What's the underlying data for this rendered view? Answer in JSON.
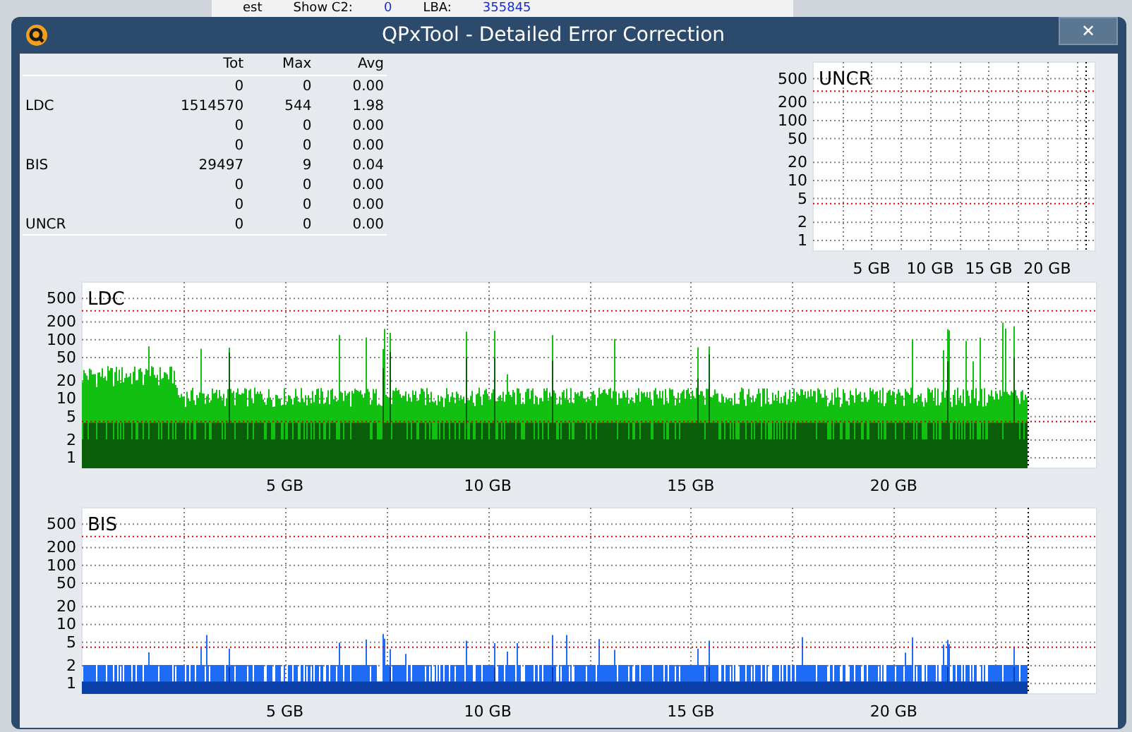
{
  "background_window": {
    "texts": [
      "est",
      "Show C2:",
      "0",
      "LBA:",
      "355845"
    ]
  },
  "window": {
    "title": "QPxTool - Detailed Error Correction",
    "close": "✕"
  },
  "stats": {
    "columns": [
      "Tot",
      "Max",
      "Avg"
    ],
    "rows": [
      {
        "values": [
          "0",
          "0",
          "0.00"
        ]
      },
      {
        "label": "LDC",
        "values": [
          "1514570",
          "544",
          "1.98"
        ]
      },
      {
        "values": [
          "0",
          "0",
          "0.00"
        ]
      },
      {
        "values": [
          "0",
          "0",
          "0.00"
        ]
      },
      {
        "label": "BIS",
        "values": [
          "29497",
          "9",
          "0.04"
        ]
      },
      {
        "values": [
          "0",
          "0",
          "0.00"
        ]
      },
      {
        "values": [
          "0",
          "0",
          "0.00"
        ]
      },
      {
        "label": "UNCR",
        "values": [
          "0",
          "0",
          "0.00"
        ]
      }
    ]
  },
  "charts": [
    {
      "kind": "uncr",
      "title": "UNCR",
      "yticks": [
        "500",
        "200",
        "100",
        "50",
        "20",
        "10",
        "5",
        "2",
        "1"
      ],
      "xticks": [
        "5 GB",
        "10 GB",
        "15 GB",
        "20 GB"
      ]
    },
    {
      "kind": "ldc",
      "title": "LDC",
      "yticks": [
        "500",
        "200",
        "100",
        "50",
        "20",
        "10",
        "5",
        "2",
        "1"
      ],
      "xticks": [
        "5 GB",
        "10 GB",
        "15 GB",
        "20 GB"
      ]
    },
    {
      "kind": "bis",
      "title": "BIS",
      "yticks": [
        "500",
        "200",
        "100",
        "50",
        "20",
        "10",
        "5",
        "2",
        "1"
      ],
      "xticks": [
        "5 GB",
        "10 GB",
        "15 GB",
        "20 GB"
      ]
    }
  ]
}
